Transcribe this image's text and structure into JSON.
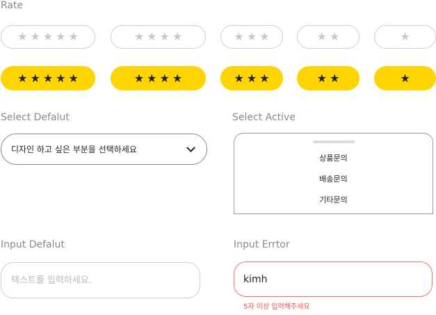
{
  "rate": {
    "label": "Rate",
    "star_glyph": "★",
    "outline_color": "#c8c8c8",
    "filled_bg": "#ffd400",
    "filled_star_color": "#222222",
    "outline_ratings": [
      5,
      4,
      3,
      2,
      1
    ],
    "filled_ratings": [
      5,
      4,
      3,
      2,
      1
    ]
  },
  "select_default": {
    "label": "Select Defalut",
    "value": "디자인 하고 싶은 부분을 선택하세요",
    "icon": "chevron-down-icon"
  },
  "select_active": {
    "label": "Select Active",
    "options": [
      "상품문의",
      "배송문의",
      "기타문의"
    ]
  },
  "input_default": {
    "label": "Input Defalut",
    "placeholder": "텍스트를 입력하세요.",
    "value": ""
  },
  "input_error": {
    "label": "Input Errtor",
    "value": "kimh",
    "error_message": "5자 이상 입력해주세요",
    "error_color": "#ff4d4d"
  }
}
